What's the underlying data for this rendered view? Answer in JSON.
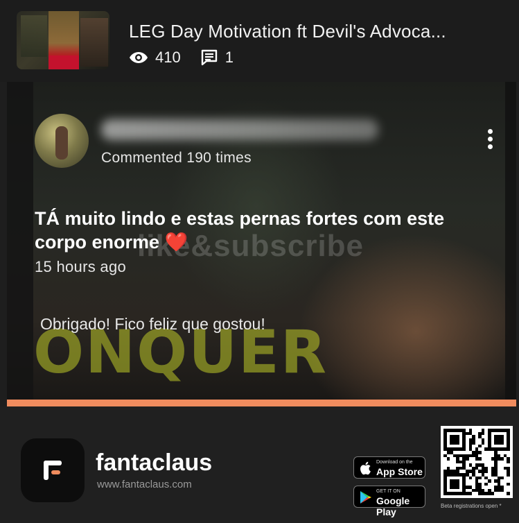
{
  "video": {
    "title": "LEG Day Motivation ft Devil's Advoca...",
    "views": "410",
    "comments": "1"
  },
  "comment": {
    "meta": "Commented 190 times",
    "text": "TÁ muito lindo e estas pernas fortes com este corpo enorme",
    "emoji": "❤️",
    "time": "15 hours ago",
    "reply": "Obrigado! Fico feliz que gostou!"
  },
  "background": {
    "watermark": "like&subscribe",
    "banner": "ONQUER"
  },
  "footer": {
    "brand": "fantaclaus",
    "site": "www.fantaclaus.com",
    "appstore_small": "Download on the",
    "appstore_big": "App Store",
    "gplay_small": "GET IT ON",
    "gplay_big": "Google Play",
    "beta": "Beta registrations open *"
  },
  "colors": {
    "accent": "#f08c5e",
    "heart": "#e8192c",
    "background": "#1e1e1e"
  },
  "icons": [
    "eye-icon",
    "comment-icon",
    "more-vert-icon",
    "apple-icon",
    "google-play-icon",
    "fantaclaus-logo"
  ]
}
